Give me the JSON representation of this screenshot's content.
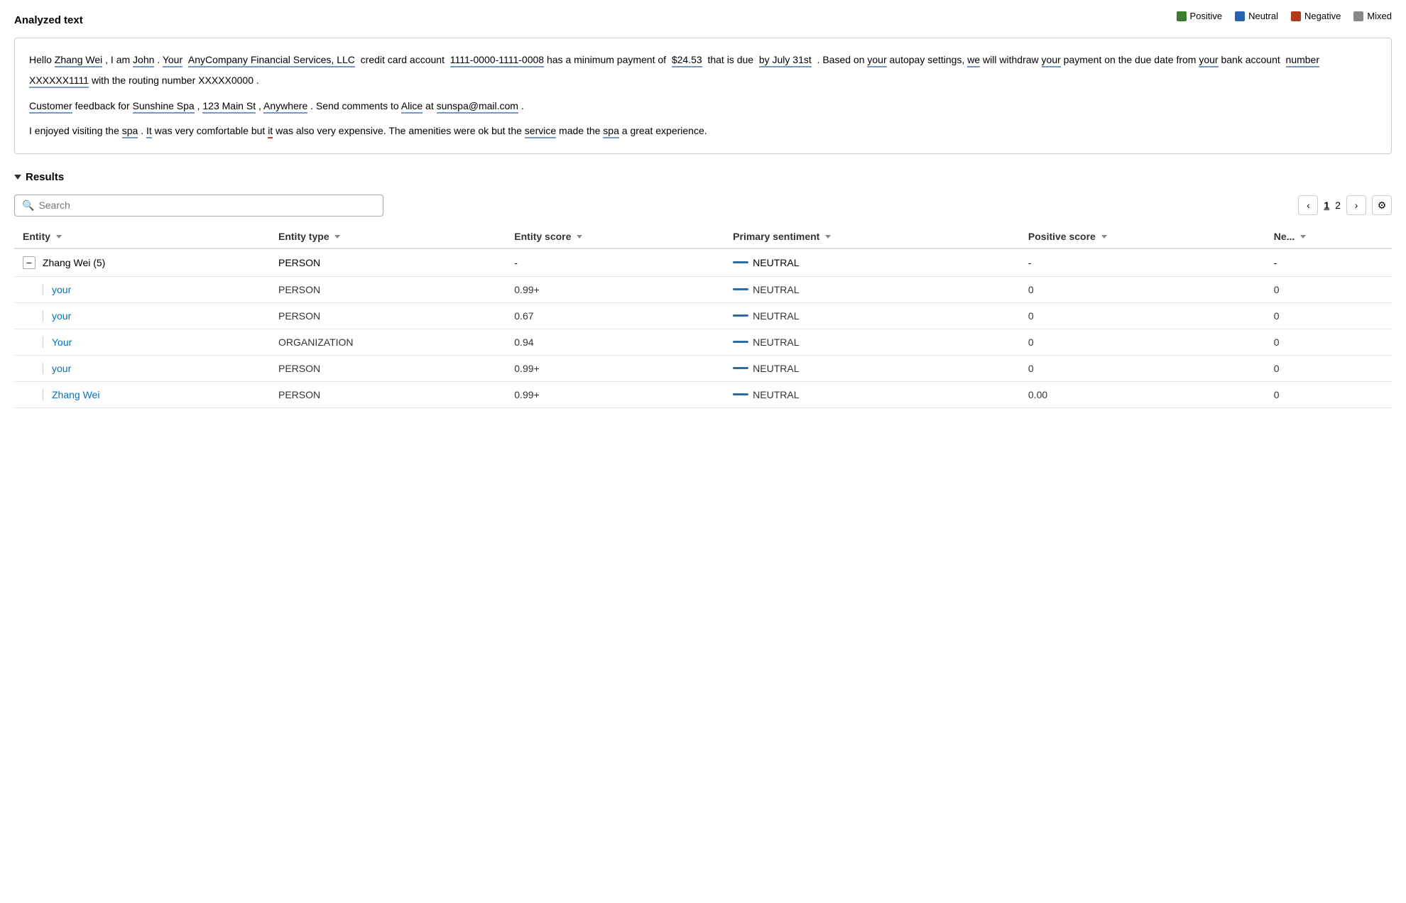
{
  "header": {
    "analyzed_text_title": "Analyzed text",
    "legend": [
      {
        "label": "Positive",
        "color": "#3a7d2a"
      },
      {
        "label": "Neutral",
        "color": "#2563ae"
      },
      {
        "label": "Negative",
        "color": "#b33a1a"
      },
      {
        "label": "Mixed",
        "color": "#666"
      }
    ]
  },
  "analyzed_text": {
    "paragraphs": [
      "Hello Zhang Wei , I am John . Your AnyCompany Financial Services, LLC credit card account 1111-0000-1111-0008 has a minimum payment of $24.53 that is due by July 31st . Based on your autopay settings, we will withdraw your payment on the due date from your bank account number XXXXXX1111 with the routing number XXXXX0000 .",
      "Customer feedback for Sunshine Spa , 123 Main St , Anywhere . Send comments to Alice at sunspa@mail.com .",
      "I enjoyed visiting the spa . It was very comfortable but it was also very expensive. The amenities were ok but the service made the spa a great experience."
    ]
  },
  "results": {
    "title": "Results",
    "search_placeholder": "Search",
    "pagination": {
      "current_page": "1",
      "next_page": "2"
    },
    "columns": [
      {
        "label": "Entity"
      },
      {
        "label": "Entity type"
      },
      {
        "label": "Entity score"
      },
      {
        "label": "Primary sentiment"
      },
      {
        "label": "Positive score"
      },
      {
        "label": "Ne..."
      }
    ],
    "rows": [
      {
        "type": "group",
        "entity": "Zhang Wei (5)",
        "entity_type": "PERSON",
        "entity_score": "-",
        "primary_sentiment": "NEUTRAL",
        "positive_score": "-",
        "ne_score": "-",
        "children": [
          {
            "entity": "your",
            "entity_type": "PERSON",
            "entity_score": "0.99+",
            "primary_sentiment": "NEUTRAL",
            "positive_score": "0",
            "ne_score": "0"
          },
          {
            "entity": "your",
            "entity_type": "PERSON",
            "entity_score": "0.67",
            "primary_sentiment": "NEUTRAL",
            "positive_score": "0",
            "ne_score": "0"
          },
          {
            "entity": "Your",
            "entity_type": "ORGANIZATION",
            "entity_score": "0.94",
            "primary_sentiment": "NEUTRAL",
            "positive_score": "0",
            "ne_score": "0"
          },
          {
            "entity": "your",
            "entity_type": "PERSON",
            "entity_score": "0.99+",
            "primary_sentiment": "NEUTRAL",
            "positive_score": "0",
            "ne_score": "0"
          },
          {
            "entity": "Zhang Wei",
            "entity_type": "PERSON",
            "entity_score": "0.99+",
            "primary_sentiment": "NEUTRAL",
            "positive_score": "0.00",
            "ne_score": "0"
          }
        ]
      }
    ]
  }
}
